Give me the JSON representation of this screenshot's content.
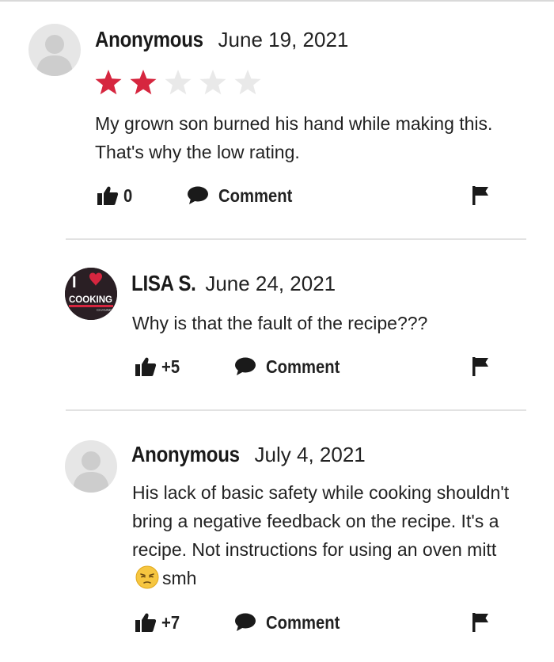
{
  "reviews": [
    {
      "author": "Anonymous",
      "date": "June 19, 2021",
      "avatar": "default-user-avatar",
      "rating": 2,
      "rating_max": 5,
      "text": "My grown son burned his hand while making this. That's why the low rating.",
      "likes": "0",
      "comment_label": "Comment"
    },
    {
      "author": "LISA S.",
      "date": "June 24, 2021",
      "avatar": "i-love-cooking-channel-logo",
      "avatar_text": {
        "line1": "I",
        "line2": "COOKING",
        "line3": "CHANNEL"
      },
      "text": "Why is that the fault of the recipe???",
      "likes": "+5",
      "comment_label": "Comment"
    },
    {
      "author": "Anonymous",
      "date": "July 4, 2021",
      "avatar": "default-user-avatar",
      "text_before_emoji": "His lack of basic safety while cooking shouldn't bring a negative feedback on the recipe. It's a recipe. Not instructions for using an oven mitt",
      "emoji": "unamused-face",
      "text_after_emoji": "smh",
      "likes": "+7",
      "comment_label": "Comment"
    }
  ],
  "colors": {
    "star_filled": "#d6263f",
    "star_empty": "#e9e9e9",
    "text": "#222222",
    "divider": "#e2e2e2"
  },
  "icons": {
    "like": "thumbs-up-icon",
    "comment": "speech-bubble-icon",
    "flag": "flag-icon"
  }
}
